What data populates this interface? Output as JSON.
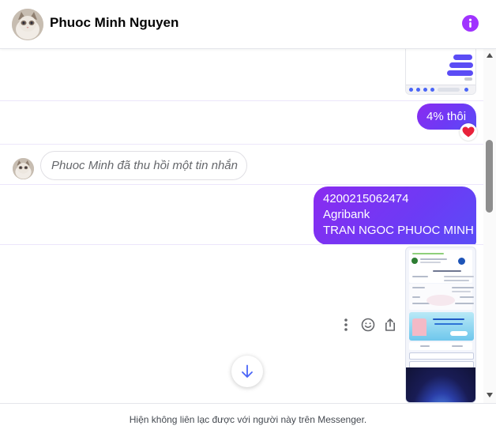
{
  "header": {
    "contact_name": "Phuoc Minh Nguyen",
    "avatar_icon": "cat-avatar-photo",
    "info_icon": "info-circle-icon",
    "accent_color": "#a033ff"
  },
  "messages": [
    {
      "kind": "image",
      "direction": "outgoing",
      "description": "screenshot of a chat"
    },
    {
      "kind": "text",
      "direction": "outgoing",
      "text": "4% thôi",
      "reaction": "❤️"
    },
    {
      "kind": "recall",
      "direction": "incoming",
      "text": "Phuoc Minh đã thu hồi một tin nhắn"
    },
    {
      "kind": "text",
      "direction": "outgoing",
      "lines": [
        "4200215062474",
        "Agribank",
        "TRAN NGOC PHUOC MINH"
      ]
    },
    {
      "kind": "image",
      "direction": "outgoing",
      "description": "bank transfer receipt screenshot"
    }
  ],
  "message_tools": [
    "more-options-icon",
    "reaction-smile-icon",
    "share-icon"
  ],
  "scroll_down_icon": "arrow-down-icon",
  "footer": {
    "notice": "Hiện không liên lạc được với người này trên Messenger."
  },
  "colors": {
    "bubble_start": "#8a2bf0",
    "bubble_end": "#5a4df7",
    "scroll_arrow": "#4a65f7"
  }
}
